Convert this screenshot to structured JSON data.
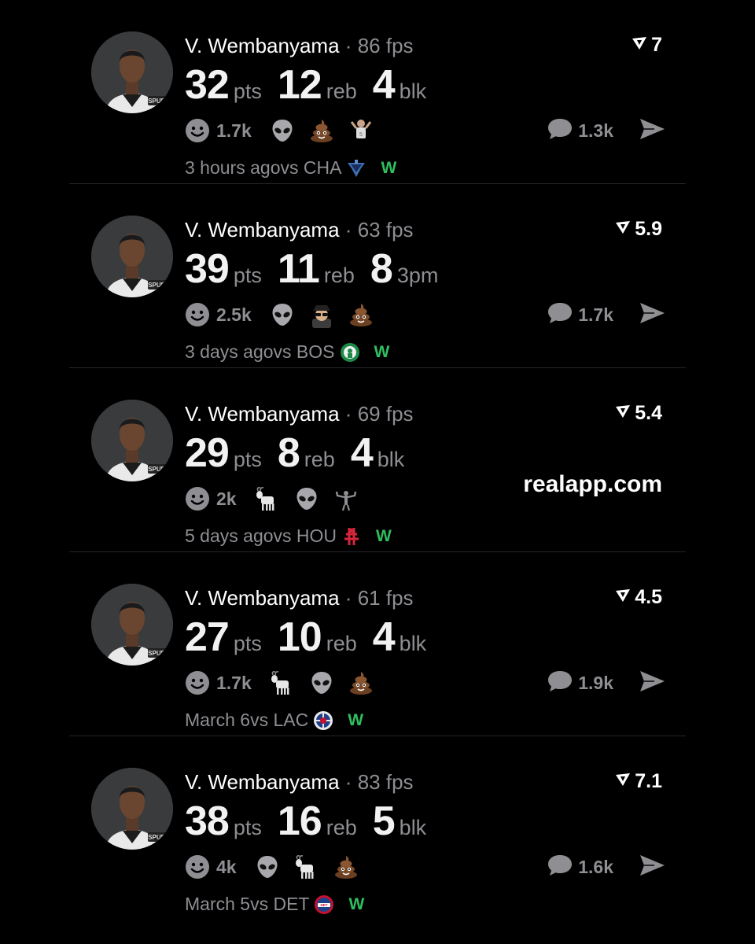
{
  "colors": {
    "background": "#000000",
    "muted": "#8e8e93",
    "win": "#2fbf5f"
  },
  "posts": [
    {
      "player": "V. Wembanyama",
      "dot": "·",
      "fps": "86 fps",
      "score": "7",
      "stats": [
        {
          "value": "32",
          "unit": "pts"
        },
        {
          "value": "12",
          "unit": "reb"
        },
        {
          "value": "4",
          "unit": "blk"
        }
      ],
      "reaction_count": "1.7k",
      "reaction_icons": [
        "alien-emoji",
        "poop-emoji",
        "player-emoji"
      ],
      "comment_count": "1.3k",
      "time": "3 hours ago",
      "opponent": "vs CHA",
      "team_logo": "hornets-logo",
      "result": "W"
    },
    {
      "player": "V. Wembanyama",
      "dot": "·",
      "fps": "63 fps",
      "score": "5.9",
      "stats": [
        {
          "value": "39",
          "unit": "pts"
        },
        {
          "value": "11",
          "unit": "reb"
        },
        {
          "value": "8",
          "unit": "3pm"
        }
      ],
      "reaction_count": "2.5k",
      "reaction_icons": [
        "alien-emoji",
        "spy-emoji",
        "poop-emoji"
      ],
      "comment_count": "1.7k",
      "time": "3 days ago",
      "opponent": "vs BOS",
      "team_logo": "celtics-logo",
      "result": "W"
    },
    {
      "player": "V. Wembanyama",
      "dot": "·",
      "fps": "69 fps",
      "score": "5.4",
      "stats": [
        {
          "value": "29",
          "unit": "pts"
        },
        {
          "value": "8",
          "unit": "reb"
        },
        {
          "value": "4",
          "unit": "blk"
        }
      ],
      "reaction_count": "2k",
      "reaction_icons": [
        "goat-emoji",
        "alien-emoji",
        "flex-emoji"
      ],
      "promo": "realapp.com",
      "time": "5 days ago",
      "opponent": "vs HOU",
      "team_logo": "rockets-logo",
      "result": "W"
    },
    {
      "player": "V. Wembanyama",
      "dot": "·",
      "fps": "61 fps",
      "score": "4.5",
      "stats": [
        {
          "value": "27",
          "unit": "pts"
        },
        {
          "value": "10",
          "unit": "reb"
        },
        {
          "value": "4",
          "unit": "blk"
        }
      ],
      "reaction_count": "1.7k",
      "reaction_icons": [
        "goat-emoji",
        "alien-emoji",
        "poop-emoji"
      ],
      "comment_count": "1.9k",
      "time": "March 6",
      "opponent": "vs LAC",
      "team_logo": "clippers-logo",
      "result": "W"
    },
    {
      "player": "V. Wembanyama",
      "dot": "·",
      "fps": "83 fps",
      "score": "7.1",
      "stats": [
        {
          "value": "38",
          "unit": "pts"
        },
        {
          "value": "16",
          "unit": "reb"
        },
        {
          "value": "5",
          "unit": "blk"
        }
      ],
      "reaction_count": "4k",
      "reaction_icons": [
        "alien-emoji",
        "goat-emoji",
        "poop-emoji"
      ],
      "comment_count": "1.6k",
      "time": "March 5",
      "opponent": "vs DET",
      "team_logo": "pistons-logo",
      "result": "W"
    }
  ]
}
